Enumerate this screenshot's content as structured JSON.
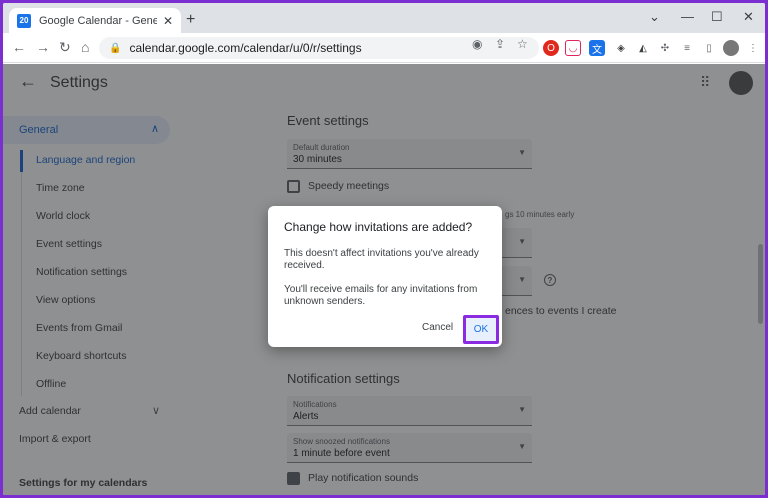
{
  "browser": {
    "tab_title": "Google Calendar - General settin",
    "favicon_text": "20",
    "url": "calendar.google.com/calendar/u/0/r/settings"
  },
  "header": {
    "title": "Settings"
  },
  "sidebar": {
    "general_label": "General",
    "sub_items": [
      "Language and region",
      "Time zone",
      "World clock",
      "Event settings",
      "Notification settings",
      "View options",
      "Events from Gmail",
      "Keyboard shortcuts",
      "Offline"
    ],
    "add_calendar": "Add calendar",
    "import_export": "Import & export",
    "my_calendars": "Settings for my calendars"
  },
  "main": {
    "event_settings_title": "Event settings",
    "default_duration": {
      "label": "Default duration",
      "value": "30 minutes"
    },
    "speedy_meetings": "Speedy meetings",
    "partial_speedy_hint": "gs 10 minutes early",
    "partial_guest_text": "ences to events I create",
    "notification_settings_title": "Notification settings",
    "notifications": {
      "label": "Notifications",
      "value": "Alerts"
    },
    "snoozed": {
      "label": "Show snoozed notifications",
      "value": "1 minute before event"
    },
    "play_sounds": "Play notification sounds"
  },
  "dialog": {
    "title": "Change how invitations are added?",
    "para1": "This doesn't affect invitations you've already received.",
    "para2": "You'll receive emails for any invitations from unknown senders.",
    "cancel_label": "Cancel",
    "ok_label": "OK"
  },
  "colors": {
    "accent": "#1a73e8",
    "highlight_border": "#8a2be2",
    "screenshot_border": "#7b2fd0"
  }
}
